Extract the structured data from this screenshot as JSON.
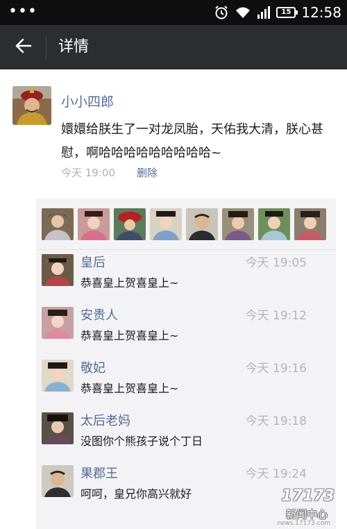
{
  "status_bar": {
    "dots": "•••",
    "battery": "15",
    "time": "12:58"
  },
  "header": {
    "title": "详情"
  },
  "post": {
    "author": "小小四郎",
    "text": "嬛嬛给朕生了一对龙凤胎，天佑我大清，朕心甚慰，啊哈哈哈哈哈哈哈哈哈~",
    "time": "今天  19:00",
    "delete_label": "删除"
  },
  "likes": [
    {
      "avatar": "avatar-1"
    },
    {
      "avatar": "avatar-2"
    },
    {
      "avatar": "avatar-3"
    },
    {
      "avatar": "avatar-4"
    },
    {
      "avatar": "avatar-5"
    },
    {
      "avatar": "avatar-6"
    },
    {
      "avatar": "avatar-7"
    },
    {
      "avatar": "avatar-8"
    }
  ],
  "comments": [
    {
      "name": "皇后",
      "time": "今天 19:05",
      "text": "恭喜皇上贺喜皇上~"
    },
    {
      "name": "安贵人",
      "time": "今天 19:12",
      "text": "恭喜皇上贺喜皇上~"
    },
    {
      "name": "敬妃",
      "time": "今天 19:16",
      "text": "恭喜皇上贺喜皇上~"
    },
    {
      "name": "太后老妈",
      "time": "今天 19:18",
      "text": "没图你个熊孩子说个丁日"
    },
    {
      "name": "果郡王",
      "time": "今天 19:24",
      "text": "呵呵，皇兄你高兴就好"
    }
  ],
  "watermark": {
    "logo": "17173",
    "site": "新闻中心",
    "url": "news.17173.com"
  },
  "colors": {
    "status_bar": "#0f0f0f",
    "header": "#2b2d30",
    "name_link": "#566b94",
    "panel": "#f3f3f5",
    "muted": "#b0b0b0"
  }
}
